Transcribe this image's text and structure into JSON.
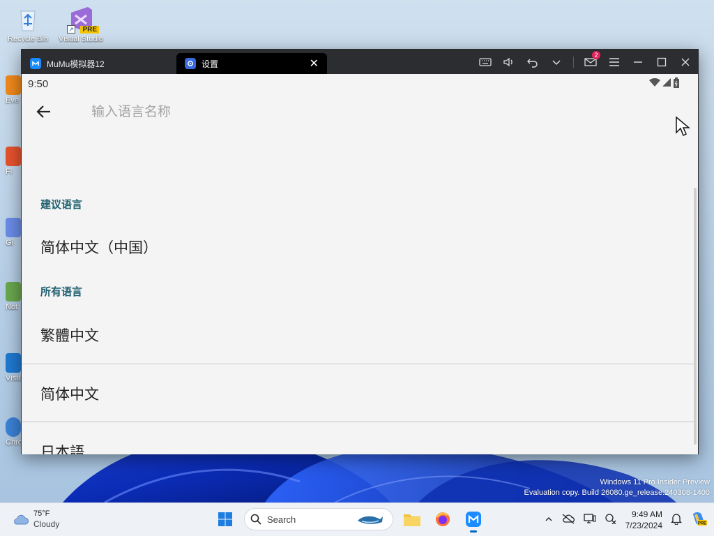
{
  "desktop": {
    "icons": [
      {
        "label": "Recycle Bin",
        "icon": "recycle-bin-icon"
      },
      {
        "label": "Visual Studio",
        "icon": "visual-studio-preview-icon",
        "badge": "PRE"
      }
    ],
    "partial_icons": [
      "Eve",
      "Fi",
      "Gi",
      "Not",
      "Visua",
      "Chromium"
    ],
    "watermark": {
      "line1": "Windows 11 Pro Insider Preview",
      "line2": "Evaluation copy. Build 26080.ge_release.240308-1400"
    }
  },
  "window": {
    "tabs": [
      {
        "label": "MuMu模拟器12",
        "icon": "mumu-logo-icon",
        "active": false
      },
      {
        "label": "设置",
        "icon": "settings-gear-icon",
        "active": true
      }
    ],
    "notification_count": "2",
    "controls": [
      "keyboard-icon",
      "volume-icon",
      "undo-icon",
      "chevron-down-icon",
      "mail-icon",
      "menu-icon",
      "minimize-icon",
      "maximize-icon",
      "close-icon"
    ]
  },
  "android": {
    "status_time": "9:50",
    "search": {
      "placeholder": "输入语言名称",
      "value": ""
    },
    "sections": {
      "suggested": {
        "title": "建议语言",
        "items": [
          "简体中文（中国）"
        ]
      },
      "all": {
        "title": "所有语言",
        "items": [
          "繁體中文",
          "简体中文",
          "日本語"
        ]
      }
    }
  },
  "taskbar": {
    "weather": {
      "temp": "75°F",
      "condition": "Cloudy"
    },
    "search_placeholder": "Search",
    "clock": {
      "time": "9:49 AM",
      "date": "7/23/2024"
    },
    "colors": {
      "accent": "#0067c0",
      "section_header": "#1d5e6e",
      "badge": "#e0245e"
    }
  }
}
